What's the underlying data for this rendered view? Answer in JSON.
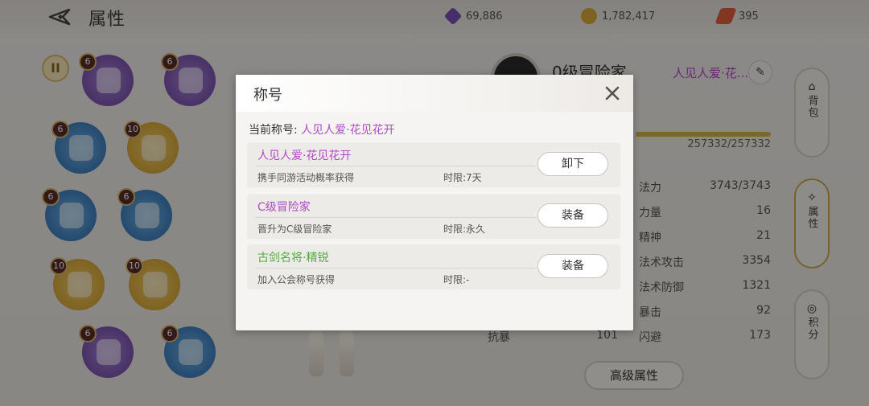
{
  "header": {
    "title": "属性",
    "currencies": [
      {
        "icon": "purple-gem-icon",
        "value": "69,886",
        "color": "#7a4fb8"
      },
      {
        "icon": "gold-coin-icon",
        "value": "1,782,417",
        "color": "#d9a93a"
      },
      {
        "icon": "stamina-icon",
        "value": "395",
        "color": "#e0603a"
      }
    ]
  },
  "equipment": [
    {
      "level": "6"
    },
    {
      "level": "6"
    },
    {
      "level": "6"
    },
    {
      "level": "10"
    },
    {
      "level": "6"
    },
    {
      "level": "6"
    },
    {
      "level": "10"
    },
    {
      "level": "10"
    },
    {
      "level": "6"
    },
    {
      "level": "6"
    }
  ],
  "character": {
    "name": "0级冒险家",
    "title": "人见人爱·花...",
    "hp": "257332/257332"
  },
  "stats": [
    {
      "key": "法力",
      "value": "3743/3743"
    },
    {
      "key": "力量",
      "value": "16"
    },
    {
      "key": "精神",
      "value": "21"
    },
    {
      "key": "法术攻击",
      "value": "3354"
    },
    {
      "key": "法术防御",
      "value": "1321"
    },
    {
      "key": "暴击",
      "value": "92"
    },
    {
      "key": "闪避",
      "value": "173"
    }
  ],
  "left_stat": {
    "key": "抗暴",
    "value": "101"
  },
  "advanced_button": "高级属性",
  "side_tabs": [
    {
      "label": "背包"
    },
    {
      "label": "属性"
    },
    {
      "label": "积分"
    }
  ],
  "dialog": {
    "title": "称号",
    "current_label": "当前称号:",
    "current_value": "人见人爱·花见花开",
    "titles": [
      {
        "name": "人见人爱·花见花开",
        "name_color": "#b347c9",
        "desc": "携手同游活动概率获得",
        "limit": "时限:7天",
        "button": "卸下"
      },
      {
        "name": "C级冒险家",
        "name_color": "#b347c9",
        "desc": "晋升为C级冒险家",
        "limit": "时限:永久",
        "button": "装备"
      },
      {
        "name": "古剑名将·精锐",
        "name_color": "#4fae3c",
        "desc": "加入公会称号获得",
        "limit": "时限:-",
        "button": "装备"
      }
    ]
  }
}
